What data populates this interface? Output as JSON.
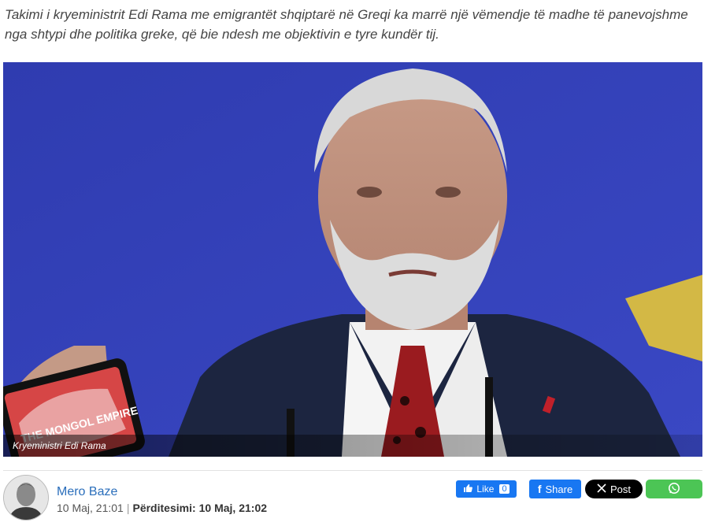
{
  "article": {
    "lead": "Takimi i kryeministrit Edi Rama me emigrantët shqiptarë në Greqi ka marrë një vëmendje të madhe të panevojshme nga shtypi dhe politika greke, që bie ndesh me objektivin e tyre kundër tij.",
    "image_caption": "Kryeministri Edi Rama",
    "phone_screen_text": "THE MONGOL EMPIRE"
  },
  "byline": {
    "author": "Mero Baze",
    "published": "10 Maj, 21:01",
    "separator": "|",
    "updated_label": "Përditesimi:",
    "updated": "10 Maj, 21:02"
  },
  "share": {
    "like_label": "Like",
    "like_count": "0",
    "share_label": "Share",
    "post_label": "Post",
    "colors": {
      "facebook": "#1877f2",
      "x": "#000000",
      "whatsapp": "#4cc555"
    }
  }
}
